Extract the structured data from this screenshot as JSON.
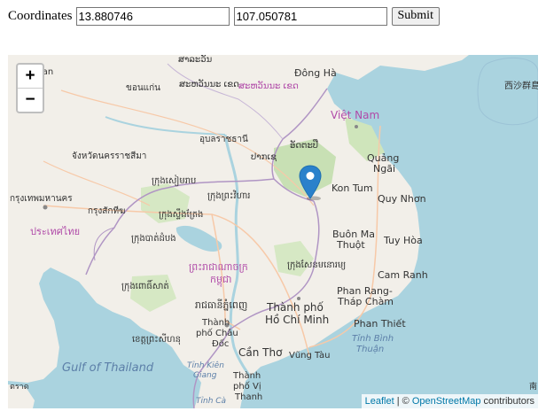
{
  "form": {
    "label": "Coordinates",
    "latitude_value": "13.880746",
    "longitude_value": "107.050781",
    "submit_label": "Submit"
  },
  "map": {
    "zoom_in_label": "+",
    "zoom_out_label": "−",
    "attribution": {
      "leaflet": "Leaflet",
      "separator": " | © ",
      "osm": "OpenStreetMap",
      "suffix": " contributors"
    },
    "colors": {
      "water": "#aad3df",
      "land": "#f2efe9",
      "forest": "#c8e0b4",
      "border": "#b095c4",
      "road": "#f7c9a8",
      "river": "#aad3df",
      "marker": "#2a81cb",
      "label": "#333333",
      "country_label": "#b04aa8",
      "link": "#0078a8"
    },
    "marker_icon": "map-pin-icon",
    "labels": {
      "saravan": "ສາລະວັນ",
      "dong_ha": "Đông Hà",
      "xisha": "西沙群島",
      "lan": "lan",
      "khonkaen": "ขอนแก่น",
      "pakse_region": "ສະຫວັນນະ ເຂດ",
      "savannakhet": "ສະຫວັນນະ ເຂດ",
      "viet_nam": "Việt Nam",
      "ubon": "อุบลราชธานี",
      "pakse": "ປາກເຊ",
      "nakhon_ratchasima": "จังหวัดนครราชสีมา",
      "attapeu": "ອັດຕະປື",
      "quang_ngai": "Quảng\nNgãi",
      "quang": "Quảng",
      "ngai": "Ngãi",
      "kon_tum": "Kon Tum",
      "bangkok": "กรุงเทพมหานคร",
      "siem_reap": "ក្រុងសៀមរាប",
      "stung_treng": "ក្រុងស្ទឹងត្រែង",
      "preah_vihear": "ក្រុងព្រះវិហារ",
      "chachoengsao": "กรุงสักทีฆ",
      "sisophon": "ក្រុងសិរីសោភ័ណ",
      "thailand": "ประเทศไทย",
      "qui_nhon": "Quy Nhơn",
      "battambang": "ក្រុងបាត់ដំបង",
      "buon_ma_thuot_1": "Buôn Ma",
      "buon_ma_thuot_2": "Thuột",
      "tuy_hoa": "Tuy Hòa",
      "cambodia_1": "ព្រះរាជាណាចក្រ",
      "cambodia_2": "កម្ពុជា",
      "senmonorom": "ក្រុងសែនមនោរម្យ",
      "cam_ranh": "Cam Ranh",
      "pursat": "ក្រុងពោធិ៍សាត់",
      "phnom_penh": "រាជធានីភ្នំពេញ",
      "phan_rang_1": "Phan Rang-",
      "phan_rang_2": "Tháp Chàm",
      "hcm_1": "Thành phố",
      "hcm_2": "Hồ Chí Minh",
      "chau_doc_1": "Thành",
      "chau_doc_2": "phố Châu",
      "chau_doc_3": "Đốc",
      "phan_thiet": "Phan Thiết",
      "koh_kong": "ខេត្តព្រះសីហនុ",
      "binh_thuan_1": "Tỉnh Bình",
      "binh_thuan_2": "Thuận",
      "gulf_of_thailand": "Gulf of Thailand",
      "can_tho": "Cần Thơ",
      "vung_tau": "Vũng Tàu",
      "kien_giang_1": "Tỉnh Kiên",
      "kien_giang_2": "Giang",
      "vi_thanh_1": "Thành",
      "vi_thanh_2": "phố Vị",
      "vi_thanh_3": "Thanh",
      "ca_mau": "Tỉnh Cà",
      "trat": "ตราด",
      "nan": "南"
    }
  }
}
